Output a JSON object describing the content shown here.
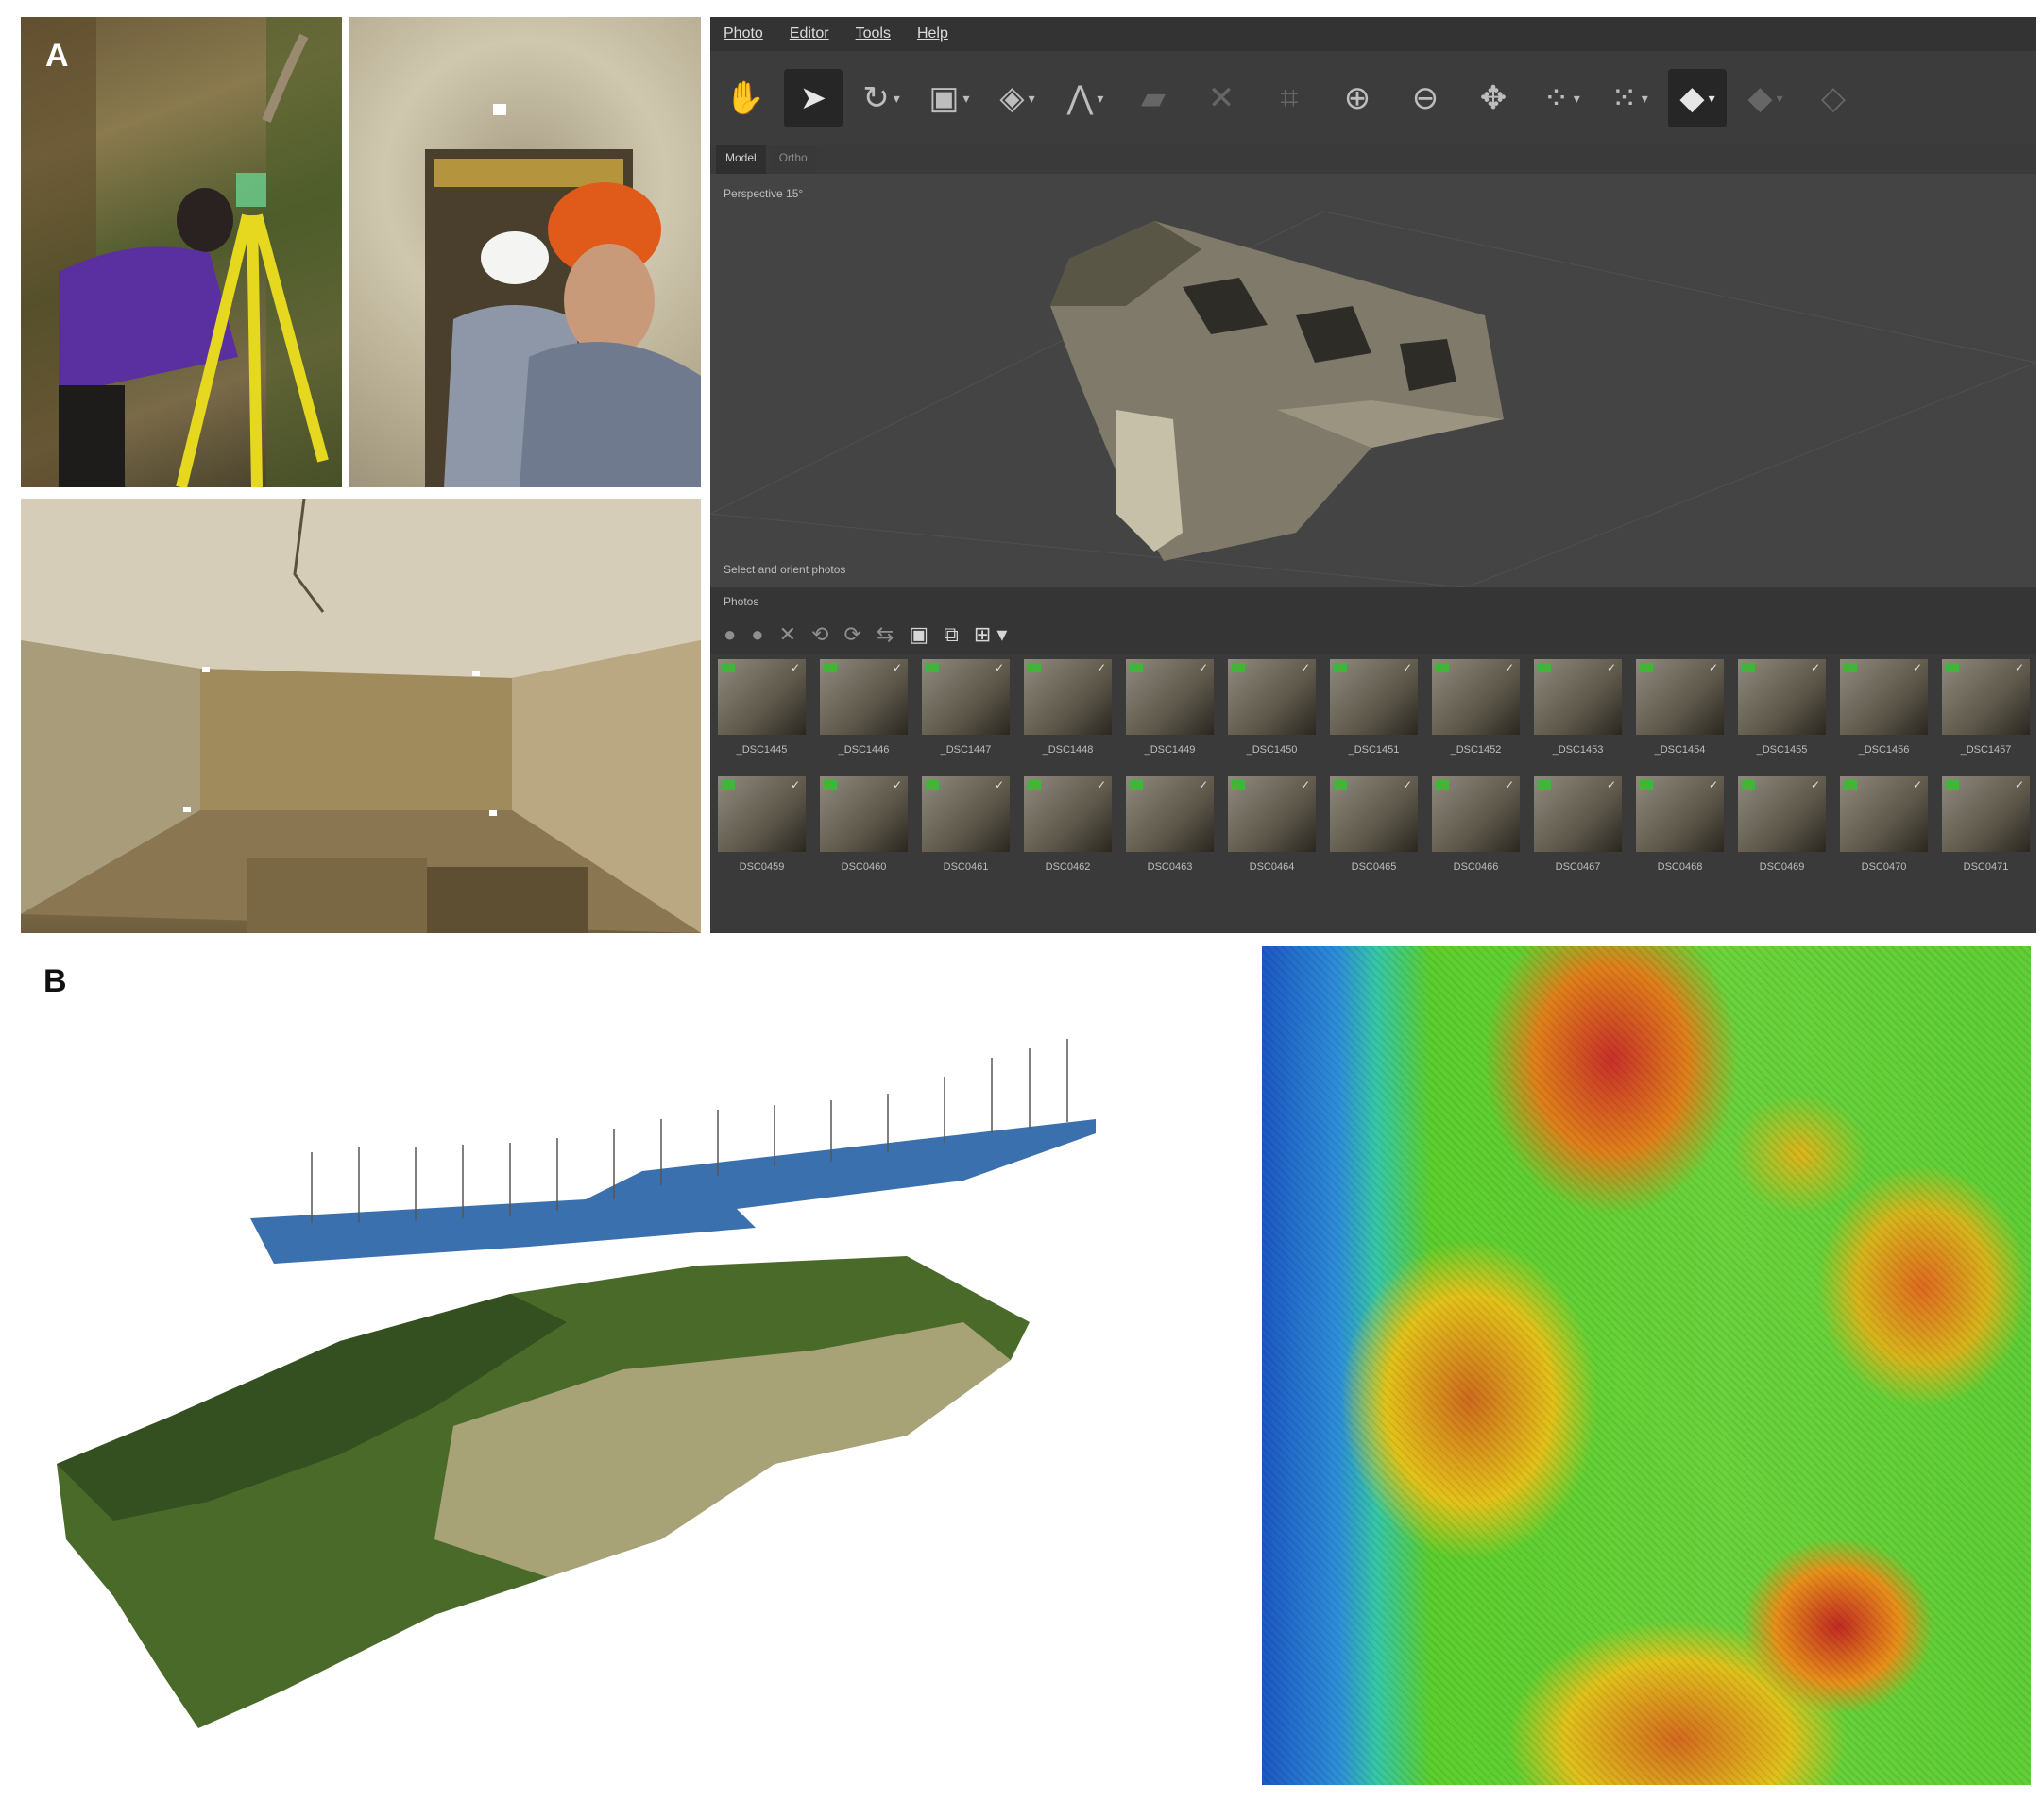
{
  "panels": {
    "a": "A",
    "b": "B"
  },
  "software": {
    "menu": [
      "Photo",
      "Editor",
      "Tools",
      "Help"
    ],
    "tabs": [
      "Model",
      "Ortho"
    ],
    "viewport_label": "Perspective 15°",
    "viewport_footer": "Select and orient photos",
    "photos_header": "Photos",
    "toolbar_icons": [
      "pan-icon",
      "select-icon",
      "rotate-icon",
      "rect-select-icon",
      "lasso-icon",
      "ruler-icon",
      "measure-icon",
      "delete-icon",
      "crop-icon",
      "zoom-in-icon",
      "zoom-out-icon",
      "move-icon",
      "cameras-icon",
      "grid-icon",
      "model-icon",
      "texture-icon",
      "shading-icon"
    ],
    "photos_row1": [
      "_DSC1445",
      "_DSC1446",
      "_DSC1447",
      "_DSC1448",
      "_DSC1449",
      "_DSC1450",
      "_DSC1451",
      "_DSC1452",
      "_DSC1453",
      "_DSC1454",
      "_DSC1455",
      "_DSC1456",
      "_DSC1457"
    ],
    "photos_row2": [
      "DSC0459",
      "DSC0460",
      "DSC0461",
      "DSC0462",
      "DSC0463",
      "DSC0464",
      "DSC0465",
      "DSC0466",
      "DSC0467",
      "DSC0468",
      "DSC0469",
      "DSC0470",
      "DSC0471"
    ]
  },
  "colors": {
    "dem_low": "#1c58c4",
    "dem_mid": "#5ccf2e",
    "dem_high": "#c8302a",
    "flight_plane": "#3a70ad"
  }
}
